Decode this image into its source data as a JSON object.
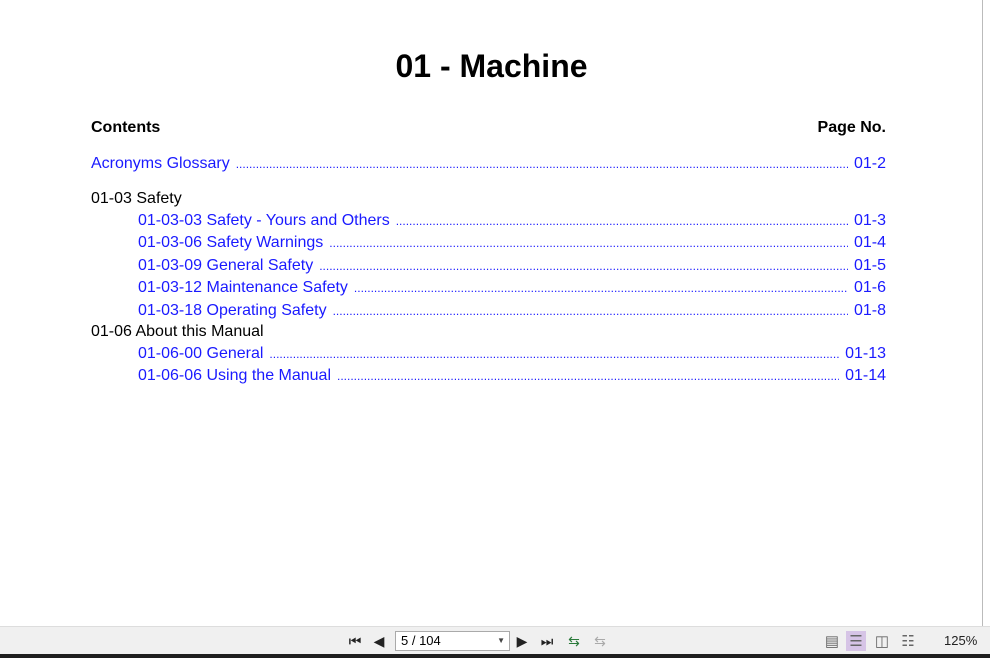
{
  "document": {
    "title": "01 - Machine",
    "contents_label": "Contents",
    "page_no_label": "Page No.",
    "glossary": {
      "label": "Acronyms Glossary",
      "page": "01-2"
    },
    "sections": [
      {
        "heading": "01-03 Safety",
        "items": [
          {
            "label": "01-03-03 Safety - Yours and Others",
            "page": "01-3"
          },
          {
            "label": "01-03-06 Safety Warnings",
            "page": "01-4"
          },
          {
            "label": "01-03-09 General Safety",
            "page": "01-5"
          },
          {
            "label": "01-03-12 Maintenance Safety",
            "page": "01-6"
          },
          {
            "label": "01-03-18 Operating Safety",
            "page": "01-8"
          }
        ]
      },
      {
        "heading": "01-06 About this Manual",
        "items": [
          {
            "label": "01-06-00 General",
            "page": "01-13"
          },
          {
            "label": "01-06-06 Using the Manual",
            "page": "01-14"
          }
        ]
      }
    ]
  },
  "toolbar": {
    "first_icon": "⏮",
    "prev_icon": "◀",
    "next_icon": "▶",
    "last_icon": "⏭",
    "page_value": "5 / 104",
    "zoom": "125%",
    "accent": "#d6c4e6"
  }
}
